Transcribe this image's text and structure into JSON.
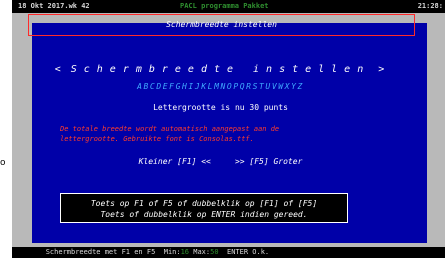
{
  "top_bar": {
    "date": "18 Okt 2017.wk 42",
    "program": "PACL programma Pakket",
    "clock": "21:28:"
  },
  "dialog": {
    "title": "Schermbreedte instellen",
    "heading_left": "<",
    "heading_text": "Schermbreedte instellen",
    "heading_right": ">",
    "alphabet": "ABCDEFGHIJKLMNOPQRSTUVWXYZ",
    "font_size_text": "Lettergrootte is nu 30 punts",
    "note_line1": "De totale breedte wordt automatisch aangepast aan de",
    "note_line2": "lettergrootte. Gebruikte font is Consolas.ttf.",
    "smaller": "Kleiner [F1] <<",
    "larger": ">> [F5] Groter",
    "instruction_line1": "Toets op F1 of F5 of dubbelklik op [F1] of [F5]",
    "instruction_line2": "Toets of dubbelklik op ENTER indien gereed."
  },
  "status_bar": {
    "prefix": "Schermbreedte met F1 en F5",
    "min_label": "Min:",
    "min_value": "16",
    "max_label": "Max:",
    "max_value": "50",
    "enter": "ENTER O.k."
  },
  "left_marker": "o",
  "colors": {
    "screen_bg": "#0000a8",
    "accent_red": "#ff2a2a",
    "alphabet_blue": "#3fa9ff",
    "program_green": "#2f8f2f"
  }
}
